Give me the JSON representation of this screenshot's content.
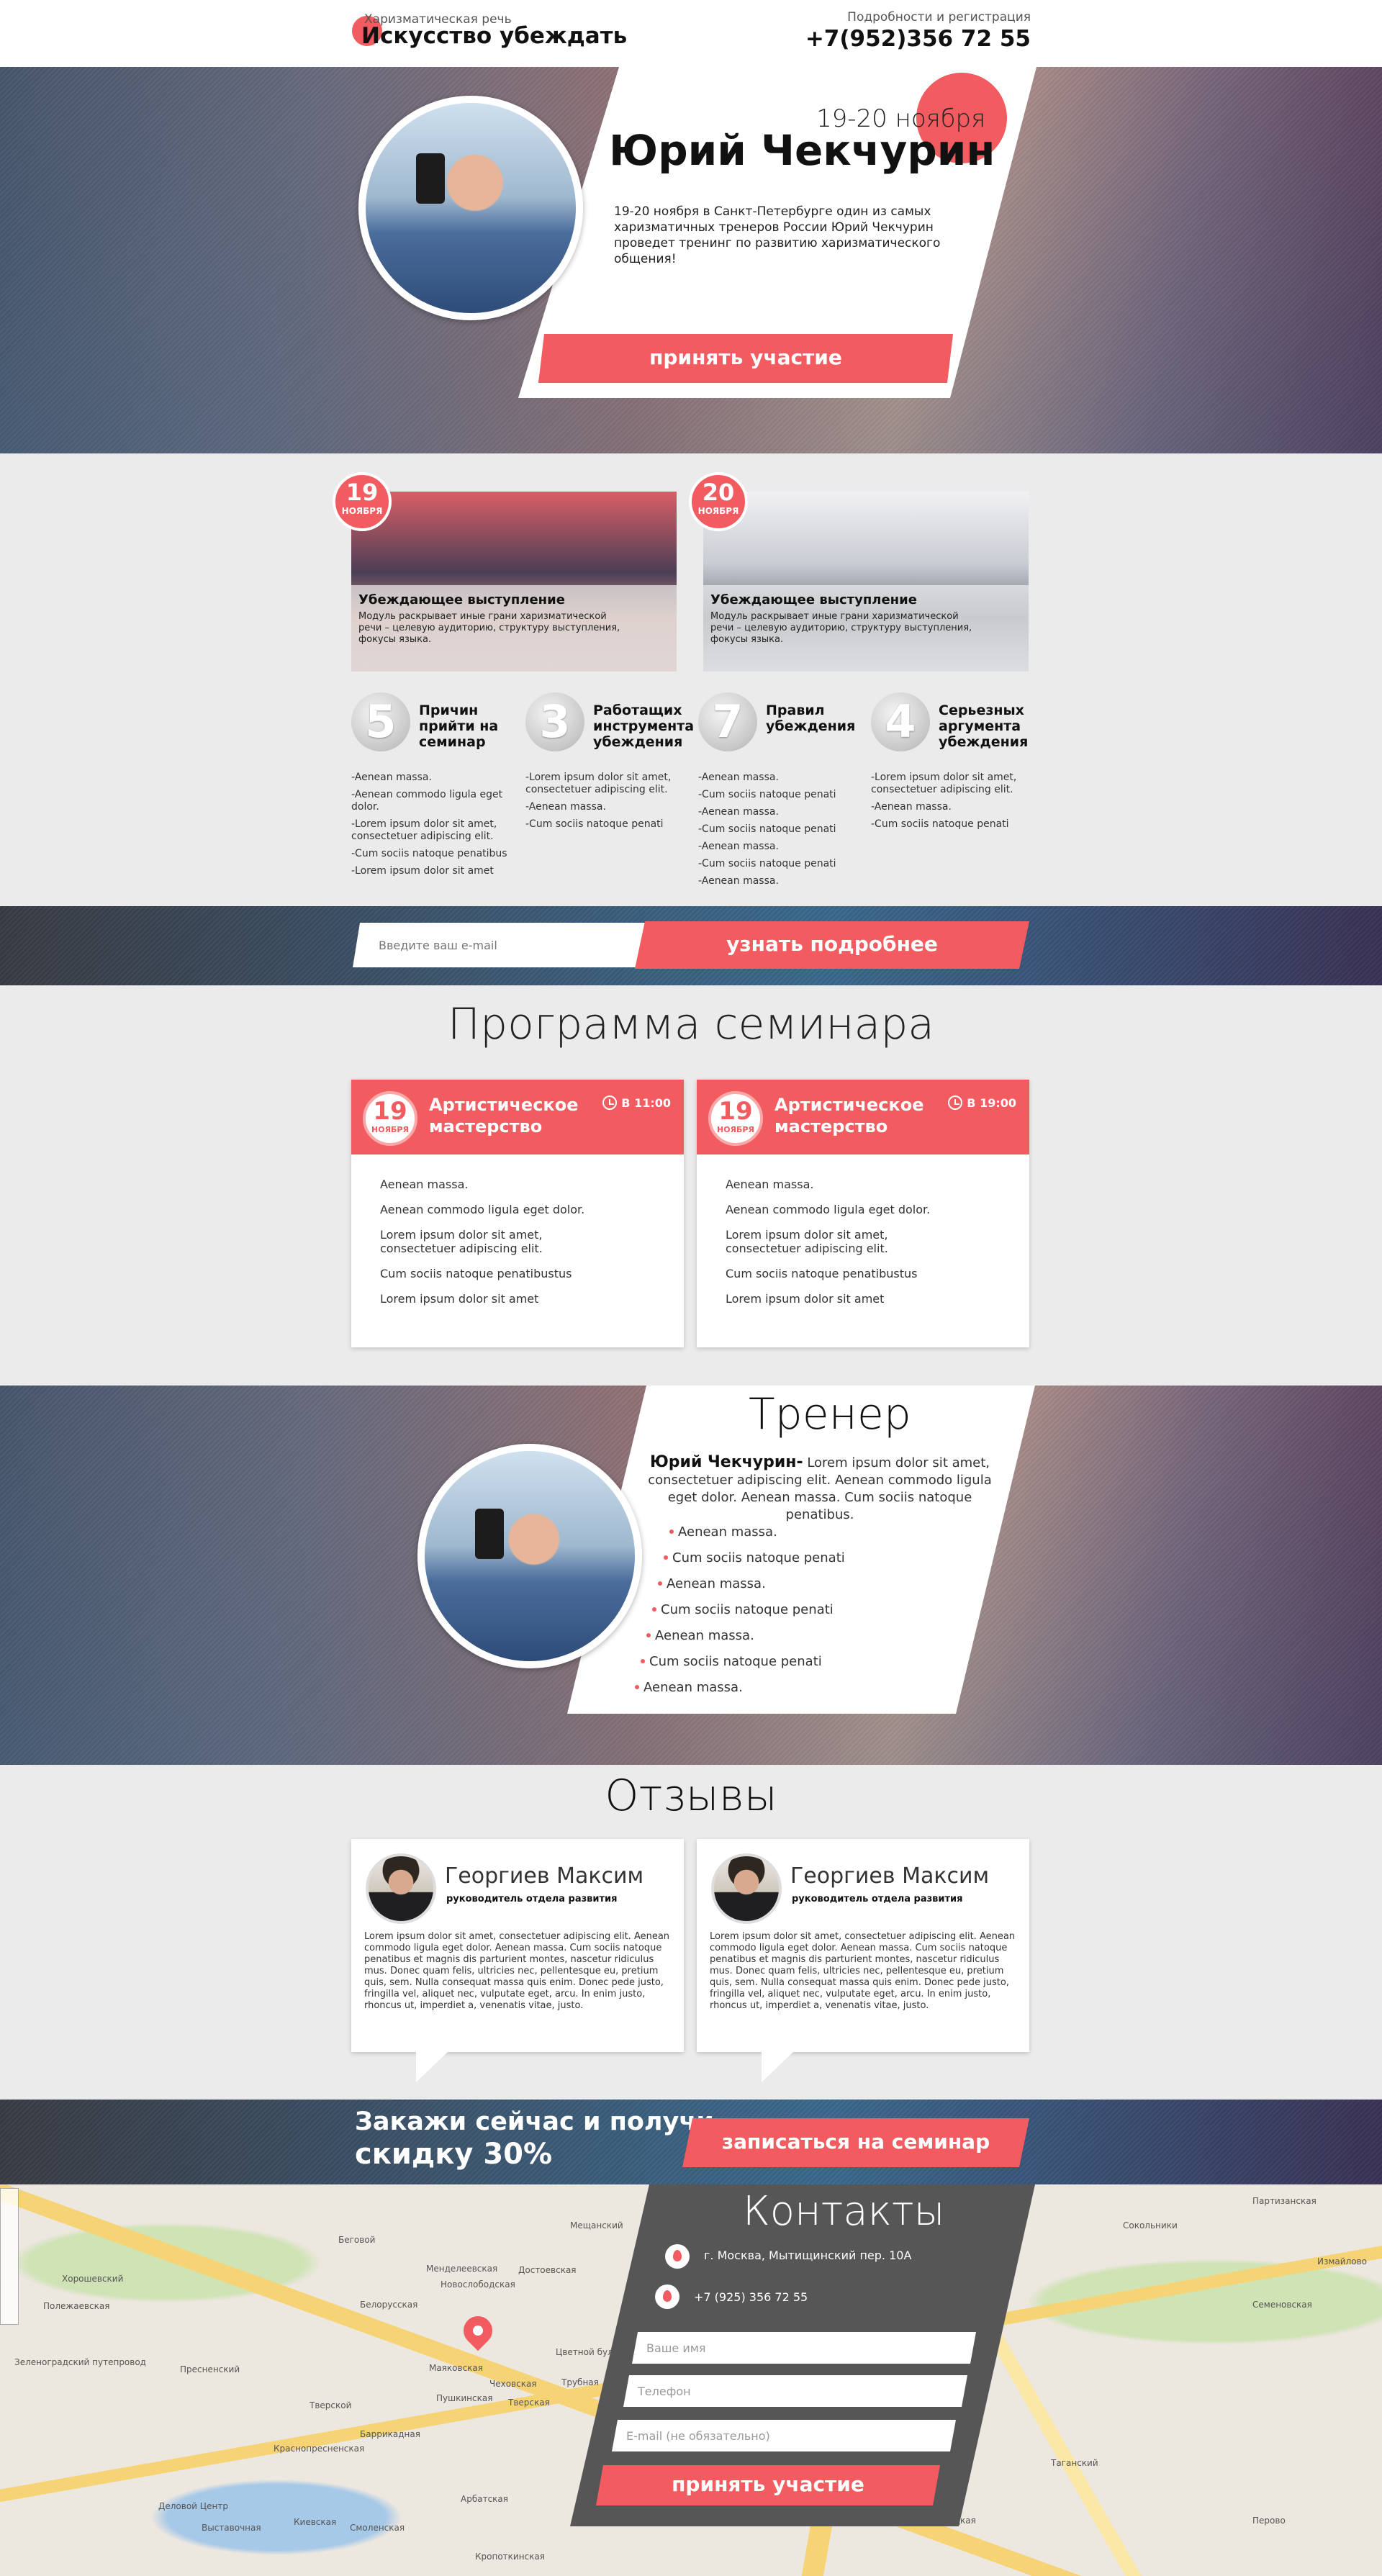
{
  "colors": {
    "accent": "#f25b5f",
    "panel_dark": "#575656",
    "bg": "#ebebeb"
  },
  "header": {
    "subtitle": "Харизматическая речь",
    "title": "Искусство убеждать",
    "reg_label": "Подробности и регистрация",
    "phone": "+7(952)356 72 55"
  },
  "hero": {
    "date": "19-20 ноября",
    "name": "Юрий Чекчурин",
    "text": "19-20 ноября в Санкт-Петербурге один из самых харизматичных тренеров России Юрий Чекчурин проведет тренинг по развитию харизматического общения!",
    "cta": "принять участие"
  },
  "days": [
    {
      "num": "19",
      "month": "НОЯБРЯ",
      "title": "Убеждающее выступление",
      "text": "Модуль раскрывает иные грани харизматической речи – целевую аудиторию, структуру выступления, фокусы языка."
    },
    {
      "num": "20",
      "month": "НОЯБРЯ",
      "title": "Убеждающее выступление",
      "text": "Модуль раскрывает иные грани харизматической речи – целевую аудиторию, структуру выступления, фокусы языка."
    }
  ],
  "features": [
    {
      "num": "5",
      "title": "Причин прийти на семинар",
      "items": [
        "-Aenean massa.",
        "-Aenean commodo ligula eget dolor.",
        "-Lorem ipsum dolor sit amet, consectetuer adipiscing elit.",
        "-Cum sociis natoque penatibus",
        "-Lorem ipsum dolor sit amet"
      ]
    },
    {
      "num": "3",
      "title": "Работащих инструмента убеждения",
      "items": [
        "-Lorem ipsum dolor sit amet, consectetuer adipiscing elit.",
        "-Aenean massa.",
        "-Cum sociis natoque penati"
      ]
    },
    {
      "num": "7",
      "title": "Правил убеждения",
      "items": [
        "-Aenean massa.",
        "-Cum sociis natoque penati",
        "-Aenean massa.",
        "-Cum sociis natoque penati",
        "-Aenean massa.",
        "-Cum sociis natoque penati",
        "-Aenean massa."
      ]
    },
    {
      "num": "4",
      "title": "Серьезных аргумента убеждения",
      "items": [
        "-Lorem ipsum dolor sit amet, consectetuer adipiscing elit.",
        "-Aenean massa.",
        "-Cum sociis natoque penati"
      ]
    }
  ],
  "email_strip": {
    "placeholder": "Введите ваш e-mail",
    "button": "узнать подробнее"
  },
  "program": {
    "title": "Программа семинара",
    "cards": [
      {
        "num": "19",
        "month": "НОЯБРЯ",
        "title": "Артистическое мастерство",
        "time": "В 11:00",
        "items": [
          "Aenean massa.",
          "Aenean commodo ligula eget dolor.",
          "Lorem ipsum dolor sit amet, consectetuer adipiscing elit.",
          "Cum sociis natoque penatibustus",
          "Lorem ipsum dolor sit amet"
        ]
      },
      {
        "num": "19",
        "month": "НОЯБРЯ",
        "title": "Артистическое мастерство",
        "time": "В 19:00",
        "items": [
          "Aenean massa.",
          "Aenean commodo ligula eget dolor.",
          "Lorem ipsum dolor sit amet, consectetuer adipiscing elit.",
          "Cum sociis natoque penatibustus",
          "Lorem ipsum dolor sit amet"
        ]
      }
    ]
  },
  "trainer": {
    "title": "Тренер",
    "name": "Юрий Чекчурин-",
    "bio": " Lorem ipsum dolor sit amet, consectetuer adipiscing elit. Aenean commodo ligula eget dolor. Aenean massa. Cum sociis natoque penatibus.",
    "items": [
      "Aenean massa.",
      "Cum sociis natoque penati",
      "Aenean massa.",
      "Cum sociis natoque penati",
      "Aenean massa.",
      "Cum sociis natoque penati",
      "Aenean massa."
    ]
  },
  "reviews": {
    "title": "Отзывы",
    "items": [
      {
        "name": "Георгиев Максим",
        "role": "руководитель отдела развития",
        "text": "Lorem ipsum dolor sit amet, consectetuer adipiscing elit. Aenean commodo ligula eget dolor. Aenean massa. Cum sociis natoque penatibus et magnis dis parturient montes, nascetur ridiculus mus. Donec quam felis, ultricies nec, pellentesque eu, pretium quis, sem. Nulla consequat massa quis enim. Donec pede justo, fringilla vel, aliquet nec, vulputate eget, arcu. In enim justo, rhoncus ut, imperdiet a, venenatis vitae, justo."
      },
      {
        "name": "Георгиев Максим",
        "role": "руководитель отдела развития",
        "text": "Lorem ipsum dolor sit amet, consectetuer adipiscing elit. Aenean commodo ligula eget dolor. Aenean massa. Cum sociis natoque penatibus et magnis dis parturient montes, nascetur ridiculus mus. Donec quam felis, ultricies nec, pellentesque eu, pretium quis, sem. Nulla consequat massa quis enim. Donec pede justo, fringilla vel, aliquet nec, vulputate eget, arcu. In enim justo, rhoncus ut, imperdiet a, venenatis vitae, justo."
      }
    ]
  },
  "offer": {
    "line1": "Закажи сейчас и получи-",
    "line2": "скидку 30%",
    "button": "записаться на семинар"
  },
  "map": {
    "labels": [
      "Беговой",
      "Хорошевский",
      "Полежаевская",
      "Менделеевская",
      "Новослободская",
      "Достоевская",
      "Белорусская",
      "Маяковская",
      "Пушкинская",
      "Чеховская",
      "Тверская",
      "Цветной бульвар",
      "Трубная",
      "Тверской",
      "Пресненский",
      "Баррикадная",
      "Краснопресненская",
      "Смоленская",
      "Арбатская",
      "Кропоткинская",
      "Киевская",
      "Деловой Центр",
      "Выставочная",
      "Зеленоградский путепровод",
      "Мещанский",
      "Сокольники",
      "Измайлово",
      "Семеновская",
      "Перово",
      "Партизанская",
      "Таганский",
      "Павелецкая"
    ]
  },
  "contacts": {
    "title": "Контакты",
    "address": "г. Москва, Мытищинский пер. 10А",
    "phone": "+7 (925) 356 72 55",
    "name_placeholder": "Ваше имя",
    "phone_placeholder": "Телефон",
    "email_placeholder": "E-mail (не обязательно)",
    "cta": "принять участие"
  }
}
